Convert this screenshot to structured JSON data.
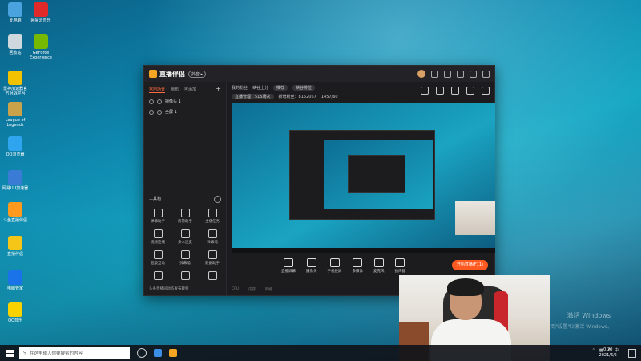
{
  "desktop": {
    "icons": [
      {
        "label": "此电脑",
        "icon": "computer-icon",
        "color": "#4aa3df"
      },
      {
        "label": "网易云音乐",
        "icon": "netease-music-icon",
        "color": "#e02a2a"
      },
      {
        "label": "回收站",
        "icon": "recycle-bin-icon",
        "color": "#cfd8dc"
      },
      {
        "label": "GeForce Experience",
        "icon": "geforce-icon",
        "color": "#76b900"
      },
      {
        "label": "雷神加速器官方对战平台",
        "icon": "game-platform-icon",
        "color": "#f2c200"
      },
      {
        "label": "League of Legends",
        "icon": "league-icon",
        "color": "#c9a24a"
      },
      {
        "label": "QQ浏览器",
        "icon": "qq-browser-icon",
        "color": "#2fa5f0"
      },
      {
        "label": "网易UU加速器",
        "icon": "uu-accelerator-icon",
        "color": "#3a7bd5"
      },
      {
        "label": "斗鱼直播伴侣",
        "icon": "douyu-icon",
        "color": "#ff9a1f"
      },
      {
        "label": "直播伴侣",
        "icon": "live-companion-icon",
        "color": "#f5c518"
      },
      {
        "label": "电脑管家",
        "icon": "pc-manager-icon",
        "color": "#1a73e8"
      },
      {
        "label": "QQ音乐",
        "icon": "qq-music-icon",
        "color": "#f9d200"
      }
    ],
    "watermark_line1": "激活 Windows",
    "watermark_line2": "转到\"设置\"以激活 Windows。"
  },
  "app": {
    "title": "直播伴侣",
    "badge": "抖音 ▸",
    "left_tabs": [
      "常用场景",
      "画布",
      "可添加"
    ],
    "add_label": "+",
    "scenes": [
      {
        "label": "摄像头 1"
      },
      {
        "label": "全屏 1"
      }
    ],
    "tools_title": "工具箱",
    "tools": [
      {
        "label": "弹幕助手",
        "icon": "chat-icon"
      },
      {
        "label": "房管助手",
        "icon": "user-icon"
      },
      {
        "label": "主播任务",
        "icon": "task-icon"
      },
      {
        "label": "视频连线",
        "icon": "video-link-icon"
      },
      {
        "label": "多人连麦",
        "icon": "multi-mic-icon"
      },
      {
        "label": "弹幕墙",
        "icon": "danmu-wall-icon"
      },
      {
        "label": "超级互动",
        "icon": "interact-icon"
      },
      {
        "label": "弹幕墙",
        "icon": "screen-icon"
      },
      {
        "label": "数据助手",
        "icon": "data-icon"
      },
      {
        "label": "",
        "icon": "gift-icon"
      },
      {
        "label": "",
        "icon": "download-icon"
      },
      {
        "label": "",
        "icon": "car-icon"
      }
    ],
    "notice": "头条直播间动态发布教程",
    "info_row1": [
      "我的粉丝",
      "峡谷上分",
      "推荐",
      "峡谷排位"
    ],
    "info_row2": [
      "直播管理：515场次",
      "新增粉丝：8152067",
      "1457/60"
    ],
    "controls": [
      {
        "label": "直播屏幕",
        "icon": "screen-share-icon"
      },
      {
        "label": "摄像头",
        "icon": "camera-icon"
      },
      {
        "label": "手机投屏",
        "icon": "phone-cast-icon"
      },
      {
        "label": "多媒体",
        "icon": "media-icon"
      },
      {
        "label": "麦克风",
        "icon": "microphone-icon"
      },
      {
        "label": "扬声器",
        "icon": "speaker-icon"
      }
    ],
    "start_label": "开始直播(F11)",
    "status": [
      "CPU",
      "内存",
      "网络"
    ]
  },
  "taskbar": {
    "search_placeholder": "在这里输入你要搜索的内容",
    "time": "0:20",
    "date": "2021/6/5",
    "input_method": "中"
  },
  "colors": {
    "accent": "#ff5a1f",
    "brand": "#f5a623"
  }
}
